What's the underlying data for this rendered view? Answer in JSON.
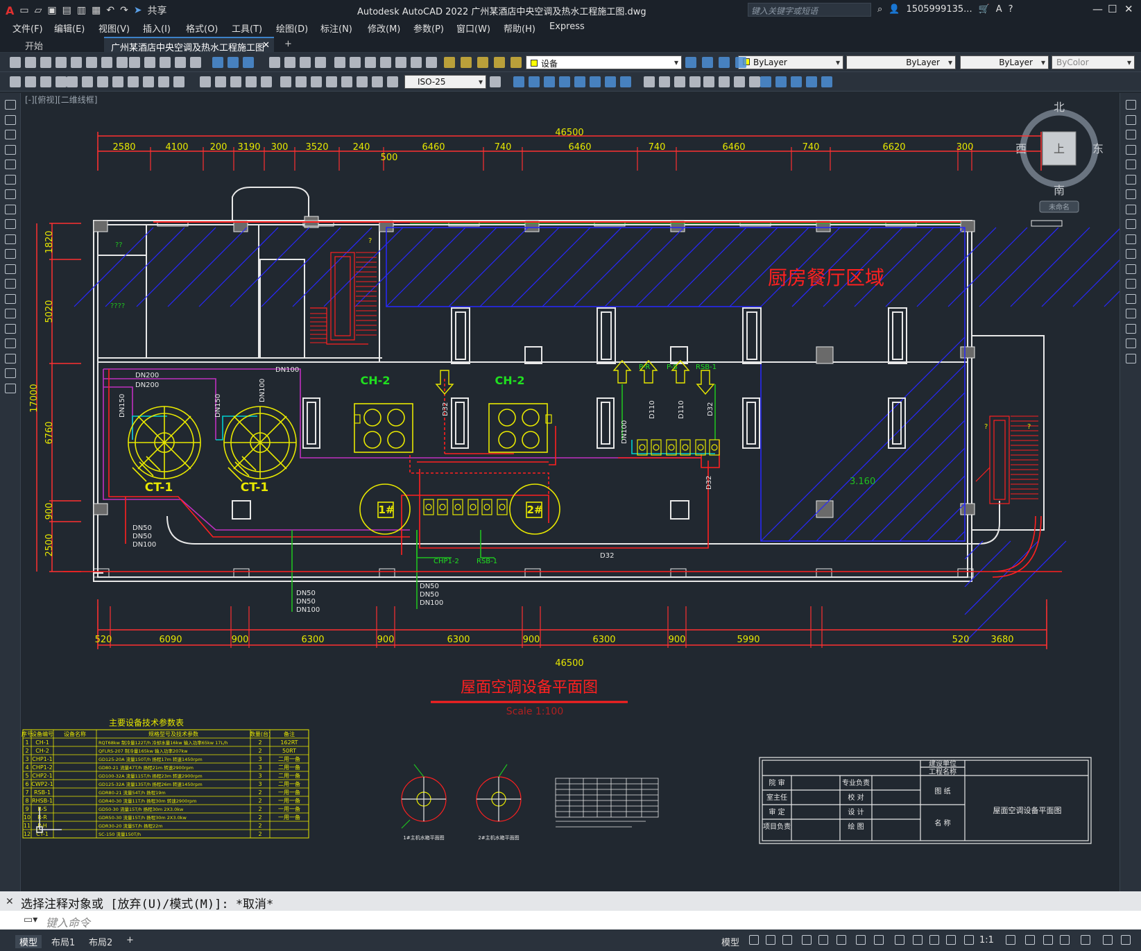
{
  "app": {
    "title": "Autodesk AutoCAD 2022    广州某酒店中央空调及热水工程施工图.dwg",
    "share": "共享",
    "search_placeholder": "键入关键字或短语",
    "user": "1505999135...",
    "logo": "A"
  },
  "menu": [
    "文件(F)",
    "编辑(E)",
    "视图(V)",
    "插入(I)",
    "格式(O)",
    "工具(T)",
    "绘图(D)",
    "标注(N)",
    "修改(M)",
    "参数(P)",
    "窗口(W)",
    "帮助(H)",
    "Express"
  ],
  "tabs": [
    {
      "label": "开始",
      "active": false
    },
    {
      "label": "广州某酒店中央空调及热水工程施工图*",
      "active": true
    }
  ],
  "toolbar": {
    "layer": "设备",
    "color": "ByLayer",
    "linetype": "ByLayer",
    "lineweight": "ByLayer",
    "plotstyle": "ByColor",
    "dimstyle": "ISO-25"
  },
  "viewport_label": "[-][俯视][二维线框]",
  "viewcube": {
    "north": "北",
    "south": "南",
    "east": "东",
    "west": "西",
    "top": "上",
    "wcs": "未命名"
  },
  "drawing": {
    "title": "屋面空调设备平面图",
    "scale": "Scale 1:100",
    "area_label": "厨房餐厅区域",
    "elevation": "3.160",
    "total_width": "46500",
    "top_dims": [
      "2580",
      "4100",
      "200",
      "3190",
      "300",
      "3520",
      "240",
      "6460",
      "740",
      "6460",
      "740",
      "6460",
      "740",
      "6620",
      "300"
    ],
    "top_sub_dim": "500",
    "bottom_dims": [
      "520",
      "6090",
      "900",
      "6300",
      "900",
      "6300",
      "900",
      "6300",
      "900",
      "5990",
      "520",
      "3680"
    ],
    "left_dims": [
      "1820",
      "5020",
      "17000",
      "6760",
      "900",
      "2500"
    ],
    "equipment": [
      "CH-2",
      "CH-2",
      "CT-1",
      "CT-1",
      "1#",
      "2#"
    ],
    "pipe_labels": [
      "DN100",
      "DN200",
      "DN200",
      "DN150",
      "DN150",
      "DN50",
      "DN50",
      "DN100",
      "DN100",
      "DN50",
      "DN50",
      "DN100",
      "DN50",
      "DN50",
      "DN100",
      "D32",
      "D32",
      "D32",
      "DN100",
      "D110",
      "D110",
      "D32",
      "CHP1-2",
      "RSB-1",
      "P-R",
      "P-S",
      "RSB-1"
    ],
    "other_labels": [
      "??",
      "????",
      "?",
      "?",
      "?"
    ],
    "table_title": "主要设备技术参数表",
    "table_headers": [
      "序号",
      "设备编号",
      "设备名称",
      "规格型号及技术参数",
      "数量(台)",
      "备注"
    ],
    "table_rows": [
      [
        "1",
        "CH-1",
        "",
        "RQT68kw 制冷量122T/h 冷却水量16kw 输入功率65kw 17L/h",
        "2",
        "162RT"
      ],
      [
        "2",
        "CH-2",
        "",
        "QFLRS-207 制冷量165kw 输入功率207kw",
        "2",
        "50RT"
      ],
      [
        "3",
        "CHP1-1",
        "",
        "GD125-20A 流量150T/h 扬程17m 转速1450rpm",
        "3",
        "二用一备"
      ],
      [
        "4",
        "CHP1-2",
        "",
        "GD80-21 流量47T/h 扬程21m 转速2900rpm",
        "3",
        "二用一备"
      ],
      [
        "5",
        "CHP2-1",
        "",
        "GD100-32A 流量115T/h 扬程23m 转速2900rpm",
        "3",
        "二用一备"
      ],
      [
        "6",
        "CWP2-1",
        "",
        "GD125-32A 流量135T/h 扬程26m 转速1450rpm",
        "3",
        "二用一备"
      ],
      [
        "7",
        "RSB-1",
        "",
        "GDR80-21 流量54T/h 扬程19m",
        "2",
        "一用一备"
      ],
      [
        "8",
        "RHSB-1",
        "",
        "GDR40-30 流量11T/h 扬程30m 转速2900rpm",
        "2",
        "一用一备"
      ],
      [
        "9",
        "R-S",
        "",
        "GD50-30 流量15T/h 扬程30m 2X3.0kw",
        "2",
        "一用一备"
      ],
      [
        "10",
        "R-R",
        "",
        "GDR50-30 流量15T/h 扬程30m 2X3.0kw",
        "2",
        "一用一备"
      ],
      [
        "11",
        "P-H",
        "",
        "GDR30-20 流量5T/h 扬程22m",
        "2",
        ""
      ],
      [
        "12",
        "CT-1",
        "",
        "SC-150 流量150T/h",
        "2",
        ""
      ]
    ],
    "detail_labels": [
      "1#主机水箱平面图",
      "2#主机水箱平面图"
    ],
    "titleblock": {
      "owner": "建设单位",
      "project": "工程名称",
      "drawing": "图 纸",
      "name": "名 称",
      "drawing_name": "屋面空调设备平面图",
      "rows": [
        [
          "院 审",
          "",
          "专业负责",
          ""
        ],
        [
          "室主任",
          "",
          "校 对",
          ""
        ],
        [
          "审 定",
          "",
          "设 计",
          ""
        ],
        [
          "项目负责",
          "",
          "绘 图",
          ""
        ]
      ]
    }
  },
  "command": {
    "history": "选择注释对象或 [放弃(U)/模式(M)]: *取消*",
    "placeholder": "键入命令"
  },
  "layouts": [
    "模型",
    "布局1",
    "布局2"
  ],
  "status": {
    "model": "模型",
    "scale": "1:1"
  },
  "colors": {
    "bg": "#212830",
    "dim": "#ff3030",
    "wall": "#e8e8e8",
    "equip": "#e8e800",
    "pipe_green": "#20c020",
    "pipe_red": "#ff2020",
    "pipe_magenta": "#c030c0",
    "hatch": "#2828ff",
    "cyan": "#00d0d0"
  }
}
